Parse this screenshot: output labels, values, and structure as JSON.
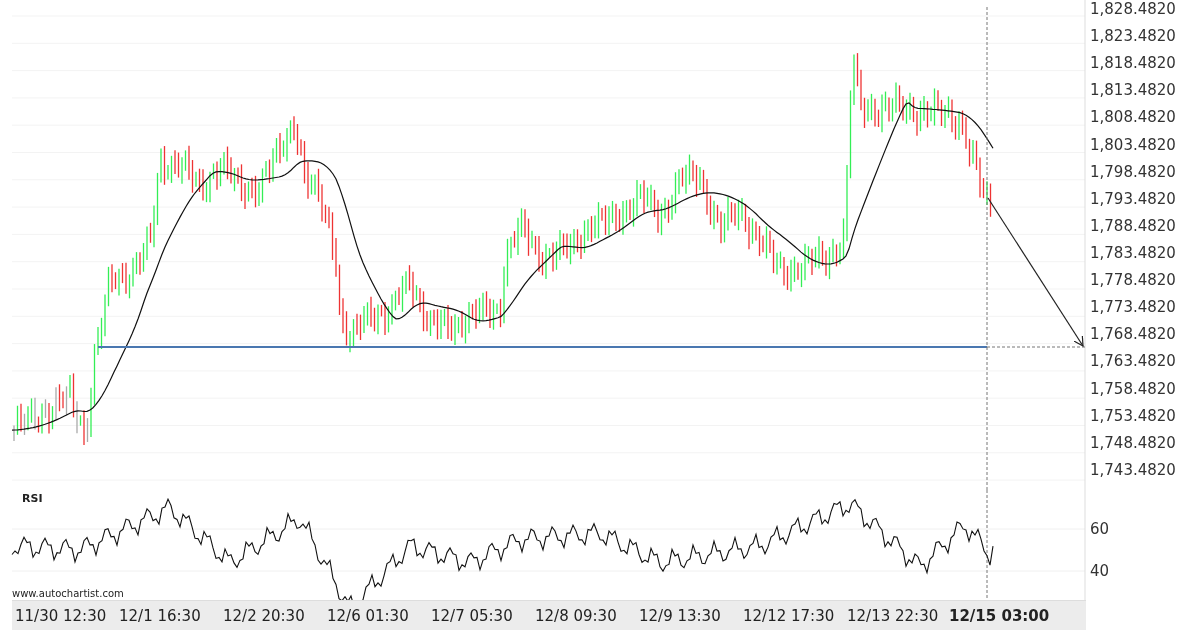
{
  "price_chart": {
    "axis_labels": [
      "1,828.4820",
      "1,823.4820",
      "1,818.4820",
      "1,813.4820",
      "1,808.4820",
      "1,803.4820",
      "1,798.4820",
      "1,793.4820",
      "1,788.4820",
      "1,783.4820",
      "1,778.4820",
      "1,773.4820",
      "1,768.4820",
      "1,763.4820",
      "1,758.4820",
      "1,753.4820",
      "1,748.4820",
      "1,743.4820"
    ]
  },
  "rsi_panel": {
    "label": "RSI",
    "axis_labels": [
      "60",
      "40"
    ]
  },
  "credit": "www.autochartist.com",
  "time_axis": [
    {
      "label": "11/30 12:30",
      "current": false
    },
    {
      "label": "12/1 16:30",
      "current": false
    },
    {
      "label": "12/2 20:30",
      "current": false
    },
    {
      "label": "12/6 01:30",
      "current": false
    },
    {
      "label": "12/7 05:30",
      "current": false
    },
    {
      "label": "12/8 09:30",
      "current": false
    },
    {
      "label": "12/9 13:30",
      "current": false
    },
    {
      "label": "12/12 17:30",
      "current": false
    },
    {
      "label": "12/13 22:30",
      "current": false
    },
    {
      "label": "12/15 03:00",
      "current": true
    }
  ]
}
